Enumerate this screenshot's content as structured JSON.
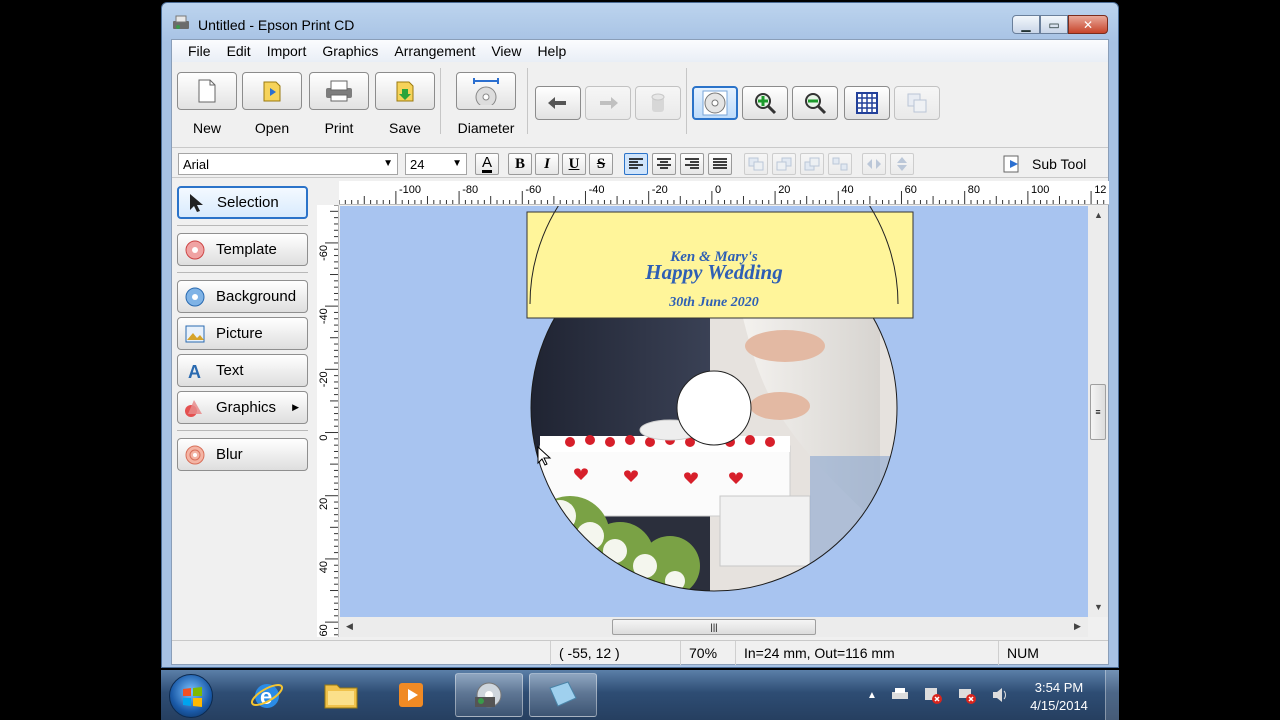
{
  "window": {
    "title": "Untitled - Epson Print CD"
  },
  "menu": [
    "File",
    "Edit",
    "Import",
    "Graphics",
    "Arrangement",
    "View",
    "Help"
  ],
  "toolbar": {
    "new": "New",
    "open": "Open",
    "print": "Print",
    "save": "Save",
    "diameter": "Diameter"
  },
  "format": {
    "font": "Arial",
    "size": "24",
    "sub_tool": "Sub Tool"
  },
  "left_panel": {
    "selection": "Selection",
    "template": "Template",
    "background": "Background",
    "picture": "Picture",
    "text": "Text",
    "graphics": "Graphics",
    "blur": "Blur"
  },
  "ruler": {
    "h_labels": [
      "-100",
      "-80",
      "-60",
      "-40",
      "-20",
      "0",
      "20",
      "40",
      "60",
      "80",
      "100",
      "12"
    ],
    "v_labels": [
      "-60",
      "-40",
      "-20",
      "0",
      "20",
      "40",
      "60"
    ]
  },
  "disc": {
    "names": "Ken & Mary's",
    "headline": "Happy Wedding",
    "date": "30th June 2020"
  },
  "status": {
    "coords": "( -55, 12 )",
    "zoom": "70%",
    "diameter": "In=24 mm, Out=116 mm",
    "num": "NUM"
  },
  "taskbar": {
    "time": "3:54 PM",
    "date": "4/15/2014"
  },
  "colors": {
    "canvas": "#a8c4f0",
    "label_bg": "#fff59a",
    "label_text": "#2e5fb4"
  }
}
